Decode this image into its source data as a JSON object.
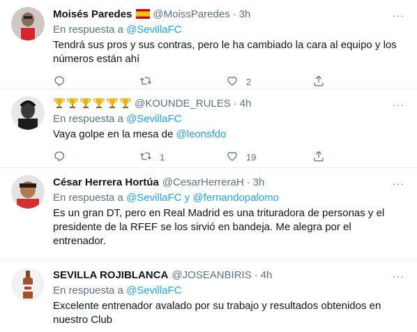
{
  "reply_prefix": "En respuesta a",
  "tweets": [
    {
      "name": "Moisés Paredes",
      "handle": "@MoissParedes",
      "dot": "·",
      "time": "3h",
      "reply_to": [
        "@SevillaFC"
      ],
      "text": "Tendrá sus pros y sus contras, pero le ha cambiado la cara al equipo y los números están ahí",
      "reply_count": "",
      "retweet_count": "",
      "like_count": "2"
    },
    {
      "name": "",
      "name_emoji": "🏆🏆🏆🏆🏆🏆",
      "handle": "@KOUNDE_RULES",
      "dot": "·",
      "time": "4h",
      "reply_to": [
        "@SevillaFC"
      ],
      "text_before": "Vaya golpe en la mesa de ",
      "text_mention": "@leonsfdo",
      "reply_count": "",
      "retweet_count": "1",
      "like_count": "19"
    },
    {
      "name": "César Herrera Hortúa",
      "handle": "@CesarHerreraH",
      "dot": "·",
      "time": "3h",
      "reply_to": [
        "@SevillaFC",
        "@fernandopalomo"
      ],
      "reply_joiner": "y",
      "text": "Es un gran DT, pero en Real Madrid es una trituradora de personas y el presidente de la RFEF se los sirvió en bandeja. Me alegra por el entrenador."
    },
    {
      "name": "SEVILLA ROJIBLANCA",
      "handle": "@JOSEANBIRIS",
      "dot": "·",
      "time": "4h",
      "reply_to": [
        "@SevillaFC"
      ],
      "text": "Excelente entrenador avalado por su trabajo y resultados obtenidos en nuestro Club"
    }
  ],
  "more_label": "···",
  "colors": {
    "link": "#1da1f2",
    "secondary": "#5b7083",
    "divider": "#ebeef0"
  },
  "icons": [
    "reply-icon",
    "retweet-icon",
    "like-icon",
    "share-icon",
    "more-icon",
    "spain-flag-icon",
    "trophy-icon"
  ]
}
